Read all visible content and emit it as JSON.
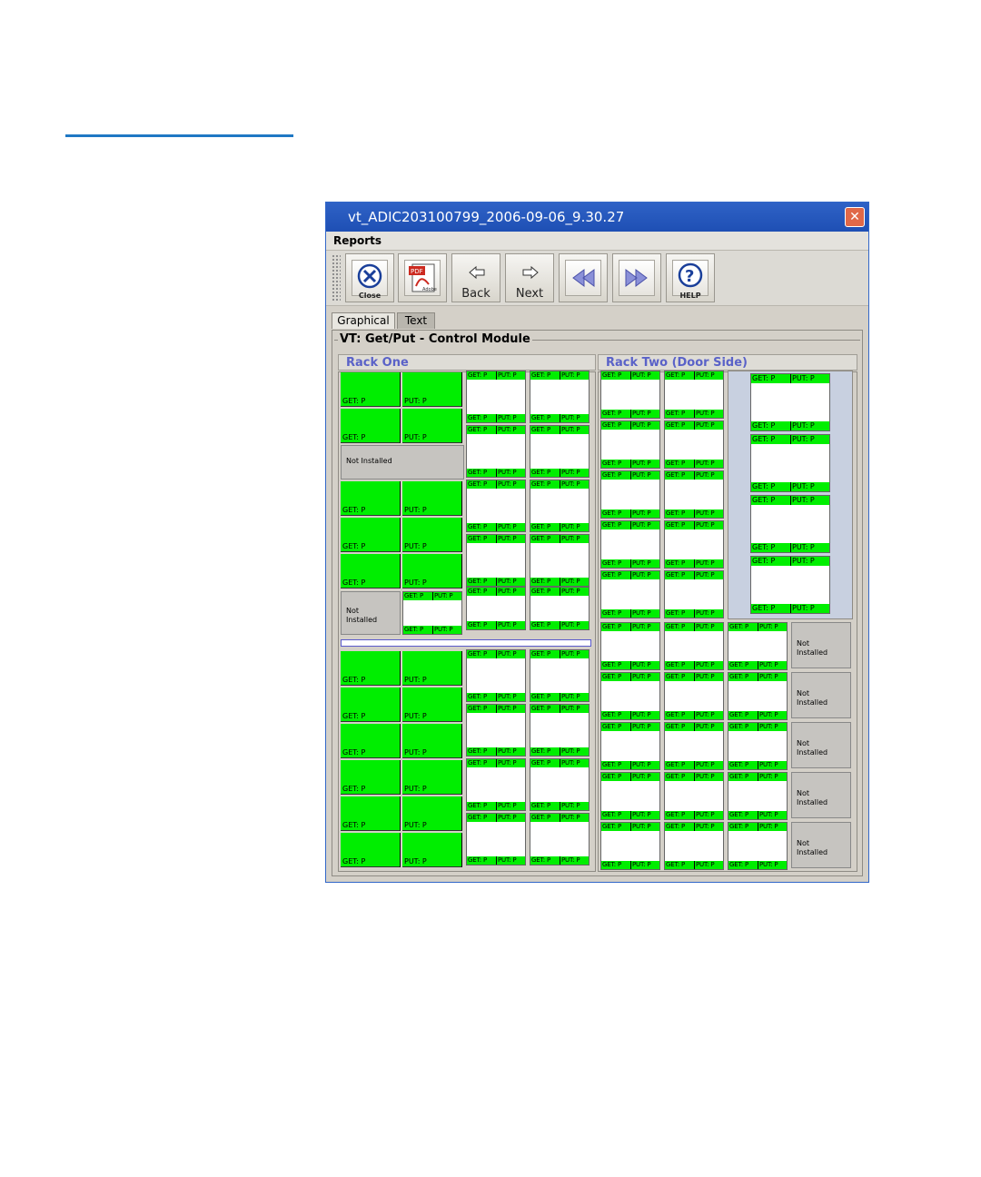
{
  "window": {
    "title": "vt_ADIC203100799_2006-09-06_9.30.27",
    "close_glyph": "✕"
  },
  "menu": {
    "reports": "Reports"
  },
  "toolbar": {
    "close_label": "Close",
    "pdf_label": "PDF",
    "adobe_label": "Adobe",
    "back_label": "Back",
    "next_label": "Next",
    "help_label": "HELP"
  },
  "tabs": {
    "graphical": "Graphical",
    "text": "Text"
  },
  "group": {
    "title": "VT: Get/Put - Control Module"
  },
  "rack_one": {
    "title": "Rack One"
  },
  "rack_two": {
    "title": "Rack Two (Door Side)"
  },
  "labels": {
    "get": "GET: P",
    "put": "PUT: P",
    "not_installed": "Not Installed",
    "not_installed_split": "Not\nInstalled"
  },
  "colors": {
    "status_ok": "#00ee00",
    "accent_rule": "#1f78c4",
    "rack_title": "#5a62c8"
  }
}
